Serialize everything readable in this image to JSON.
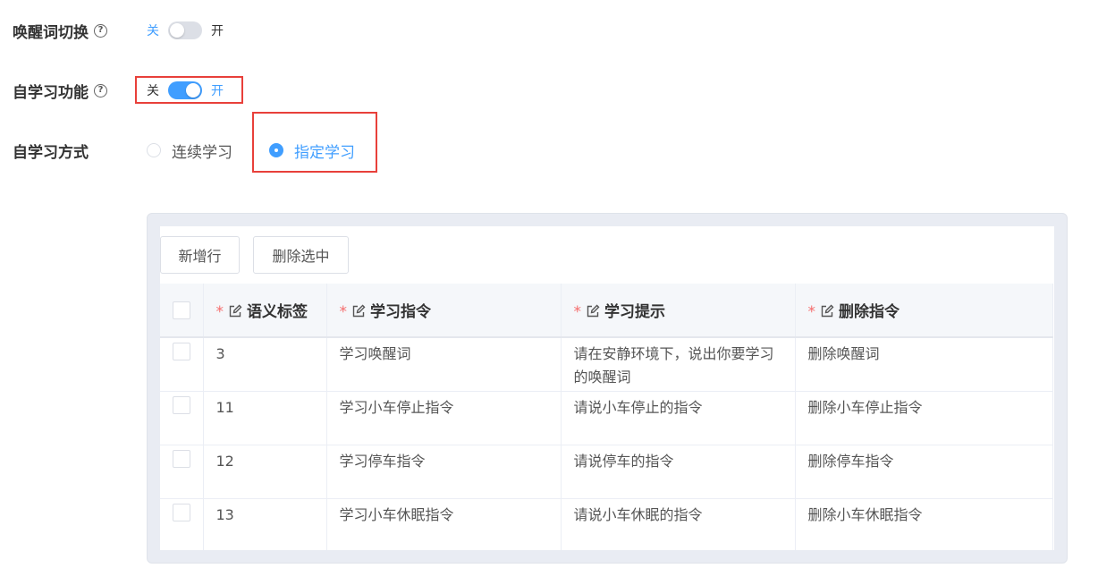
{
  "wake_word_switch": {
    "label": "唤醒词切换",
    "off_text": "关",
    "on_text": "开",
    "state": "off"
  },
  "self_learning_switch": {
    "label": "自学习功能",
    "off_text": "关",
    "on_text": "开",
    "state": "on"
  },
  "learning_mode": {
    "label": "自学习方式",
    "options": [
      {
        "label": "连续学习",
        "checked": false
      },
      {
        "label": "指定学习",
        "checked": true
      }
    ]
  },
  "toolbar": {
    "add_row_label": "新增行",
    "delete_selected_label": "删除选中"
  },
  "table": {
    "required_mark": "*",
    "columns": [
      "语义标签",
      "学习指令",
      "学习提示",
      "删除指令"
    ],
    "rows": [
      {
        "tag": "3",
        "learn_cmd": "学习唤醒词",
        "hint": "请在安静环境下，说出你要学习的唤醒词",
        "delete_cmd": "删除唤醒词"
      },
      {
        "tag": "11",
        "learn_cmd": "学习小车停止指令",
        "hint": "请说小车停止的指令",
        "delete_cmd": "删除小车停止指令"
      },
      {
        "tag": "12",
        "learn_cmd": "学习停车指令",
        "hint": "请说停车的指令",
        "delete_cmd": "删除停车指令"
      },
      {
        "tag": "13",
        "learn_cmd": "学习小车休眠指令",
        "hint": "请说小车休眠的指令",
        "delete_cmd": "删除小车休眠指令"
      }
    ]
  },
  "colors": {
    "accent": "#409eff",
    "highlight_box": "#e8403a",
    "required": "#f56c6c"
  }
}
